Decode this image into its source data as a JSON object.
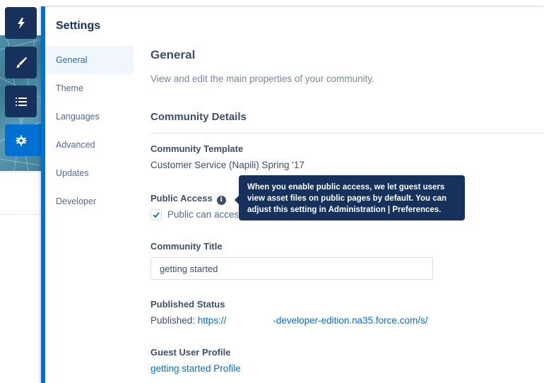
{
  "rail": {
    "buttons": [
      {
        "icon": "lightning-icon",
        "label": "Components"
      },
      {
        "icon": "brush-icon",
        "label": "Theme"
      },
      {
        "icon": "list-icon",
        "label": "Page Structure"
      },
      {
        "icon": "gear-icon",
        "label": "Settings",
        "active": true
      }
    ]
  },
  "settings": {
    "title": "Settings",
    "nav": [
      {
        "label": "General",
        "active": true
      },
      {
        "label": "Theme"
      },
      {
        "label": "Languages"
      },
      {
        "label": "Advanced"
      },
      {
        "label": "Updates"
      },
      {
        "label": "Developer"
      }
    ]
  },
  "general": {
    "heading": "General",
    "description": "View and edit the main properties of your community.",
    "section_heading": "Community Details",
    "template": {
      "label": "Community Template",
      "value": "Customer Service (Napili) Spring '17"
    },
    "public_access": {
      "label": "Public Access",
      "checkbox_label": "Public can access the community",
      "checked": true,
      "tooltip": "When you enable public access, we let guest users view asset files on public pages by default. You can adjust this setting in Administration | Preferences."
    },
    "community_title": {
      "label": "Community Title",
      "value": "getting started"
    },
    "published_status": {
      "label": "Published Status",
      "prefix": "Published: ",
      "url_start": "https://",
      "url_end": "-developer-edition.na35.force.com/s/"
    },
    "guest_profile": {
      "label": "Guest User Profile",
      "value": "getting started Profile"
    }
  },
  "colors": {
    "brand": "#0070d2",
    "navy": "#16325c",
    "text": "#3e4f67"
  }
}
